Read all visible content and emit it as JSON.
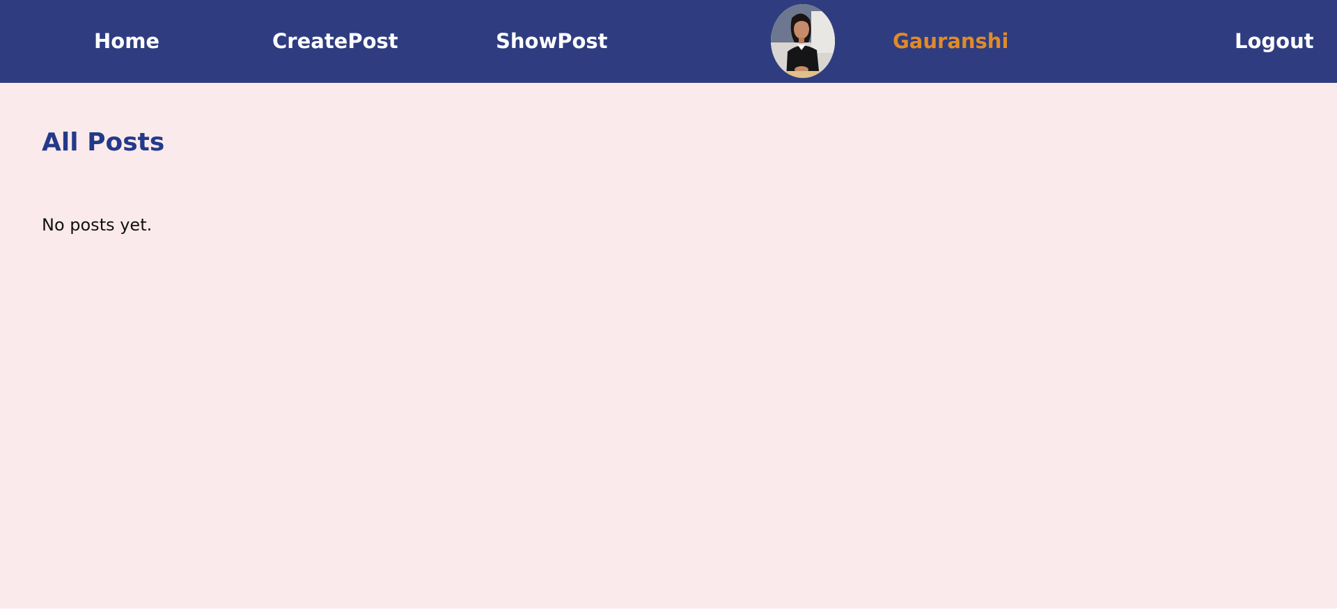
{
  "nav": {
    "home_label": "Home",
    "create_label": "CreatePost",
    "show_label": "ShowPost",
    "user_name": "Gauranshi",
    "logout_label": "Logout",
    "avatar_icon": "user-avatar-photo"
  },
  "main": {
    "title": "All Posts",
    "empty_message": "No posts yet."
  },
  "colors": {
    "navbar_bg": "#2f3d80",
    "page_bg": "#fbeaeb",
    "title": "#233a8a",
    "username": "#e08a2a",
    "nav_text": "#ffffff"
  }
}
